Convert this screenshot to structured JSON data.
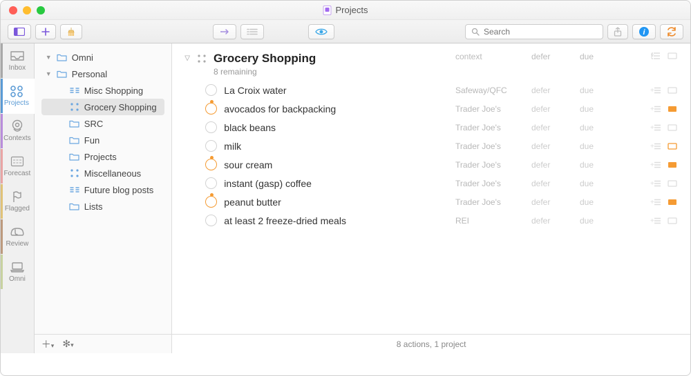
{
  "window": {
    "title": "Projects"
  },
  "toolbar": {
    "search_placeholder": "Search"
  },
  "rail": [
    {
      "id": "inbox",
      "label": "Inbox"
    },
    {
      "id": "projects",
      "label": "Projects"
    },
    {
      "id": "contexts",
      "label": "Contexts"
    },
    {
      "id": "forecast",
      "label": "Forecast"
    },
    {
      "id": "flagged",
      "label": "Flagged"
    },
    {
      "id": "review",
      "label": "Review"
    },
    {
      "id": "omni",
      "label": "Omni"
    }
  ],
  "sidebar": {
    "rows": [
      {
        "type": "folder",
        "label": "Omni",
        "expanded": true
      },
      {
        "type": "folder",
        "label": "Personal",
        "expanded": true
      },
      {
        "type": "project-parallel",
        "label": "Misc Shopping",
        "indent": 1
      },
      {
        "type": "project-parallel-dots",
        "label": "Grocery Shopping",
        "indent": 1,
        "selected": true
      },
      {
        "type": "folder-closed",
        "label": "SRC",
        "indent": 1
      },
      {
        "type": "folder-closed",
        "label": "Fun",
        "indent": 1
      },
      {
        "type": "folder-closed",
        "label": "Projects",
        "indent": 1
      },
      {
        "type": "project-parallel-dots",
        "label": "Miscellaneous",
        "indent": 1
      },
      {
        "type": "project-parallel",
        "label": "Future blog posts",
        "indent": 1
      },
      {
        "type": "folder-closed",
        "label": "Lists",
        "indent": 1
      }
    ]
  },
  "content": {
    "title": "Grocery Shopping",
    "subtitle": "8 remaining",
    "columns": {
      "context": "context",
      "defer": "defer",
      "due": "due"
    },
    "tasks": [
      {
        "title": "La Croix water",
        "context": "Safeway/QFC",
        "defer": "defer",
        "due": "due",
        "flagged": false,
        "flag_card": false
      },
      {
        "title": "avocados for backpacking",
        "context": "Trader Joe's",
        "defer": "defer",
        "due": "due",
        "flagged": true,
        "flag_card": true
      },
      {
        "title": "black beans",
        "context": "Trader Joe's",
        "defer": "defer",
        "due": "due",
        "flagged": false,
        "flag_card": false
      },
      {
        "title": "milk",
        "context": "Trader Joe's",
        "defer": "defer",
        "due": "due",
        "flagged": false,
        "flag_card": true,
        "card_outline": true
      },
      {
        "title": "sour cream",
        "context": "Trader Joe's",
        "defer": "defer",
        "due": "due",
        "flagged": true,
        "flag_card": true
      },
      {
        "title": "instant (gasp) coffee",
        "context": "Trader Joe's",
        "defer": "defer",
        "due": "due",
        "flagged": false,
        "flag_card": false
      },
      {
        "title": "peanut butter",
        "context": "Trader Joe's",
        "defer": "defer",
        "due": "due",
        "flagged": true,
        "flag_card": true
      },
      {
        "title": "at least 2 freeze-dried meals",
        "context": "REI",
        "defer": "defer",
        "due": "due",
        "flagged": false,
        "flag_card": false
      }
    ]
  },
  "statusbar": "8 actions, 1 project"
}
